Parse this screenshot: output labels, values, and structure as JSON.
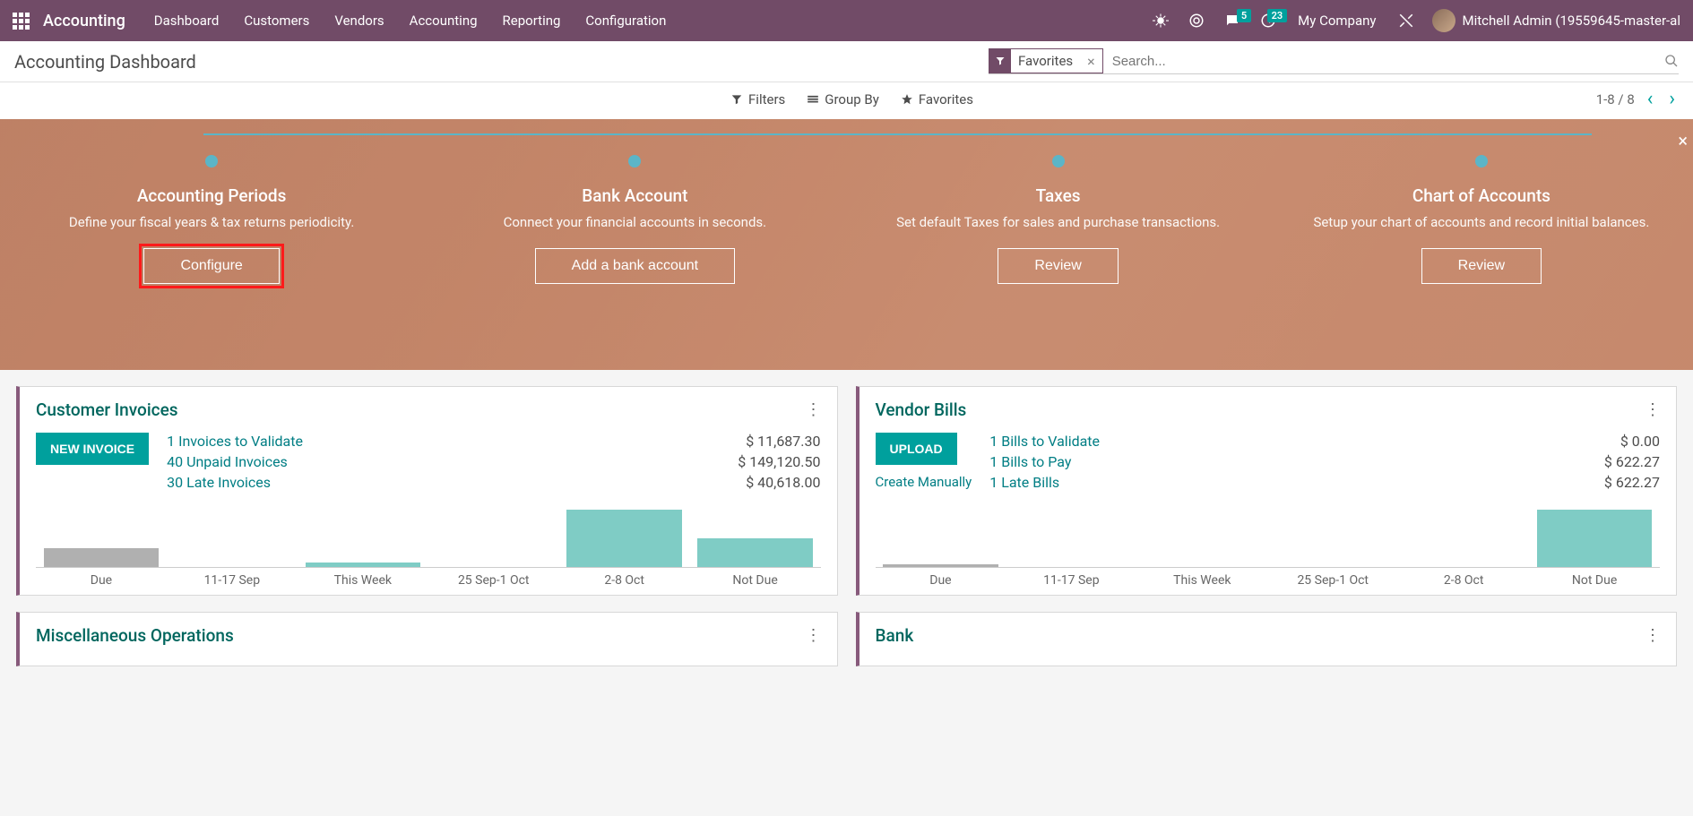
{
  "topbar": {
    "app_name": "Accounting",
    "menu": [
      "Dashboard",
      "Customers",
      "Vendors",
      "Accounting",
      "Reporting",
      "Configuration"
    ],
    "msg_badge": "5",
    "act_badge": "23",
    "company": "My Company",
    "user": "Mitchell Admin (19559645-master-al"
  },
  "page": {
    "title": "Accounting Dashboard",
    "facet_label": "Favorites",
    "search_placeholder": "Search...",
    "filters": "Filters",
    "groupby": "Group By",
    "favorites": "Favorites",
    "pager": "1-8 / 8"
  },
  "steps": [
    {
      "title": "Accounting Periods",
      "desc": "Define your fiscal years & tax returns periodicity.",
      "btn": "Configure",
      "hl": true
    },
    {
      "title": "Bank Account",
      "desc": "Connect your financial accounts in seconds.",
      "btn": "Add a bank account",
      "hl": false
    },
    {
      "title": "Taxes",
      "desc": "Set default Taxes for sales and purchase transactions.",
      "btn": "Review",
      "hl": false
    },
    {
      "title": "Chart of Accounts",
      "desc": "Setup your chart of accounts and record initial balances.",
      "btn": "Review",
      "hl": false
    }
  ],
  "cards": {
    "ci": {
      "title": "Customer Invoices",
      "action": "NEW INVOICE",
      "stats": [
        {
          "label": "1 Invoices to Validate",
          "val": "$ 11,687.30"
        },
        {
          "label": "40 Unpaid Invoices",
          "val": "$ 149,120.50"
        },
        {
          "label": "30 Late Invoices",
          "val": "$ 40,618.00"
        }
      ]
    },
    "vb": {
      "title": "Vendor Bills",
      "action": "UPLOAD",
      "link": "Create Manually",
      "stats": [
        {
          "label": "1 Bills to Validate",
          "val": "$ 0.00"
        },
        {
          "label": "1 Bills to Pay",
          "val": "$ 622.27"
        },
        {
          "label": "1 Late Bills",
          "val": "$ 622.27"
        }
      ]
    },
    "misc": {
      "title": "Miscellaneous Operations"
    },
    "bank": {
      "title": "Bank"
    }
  },
  "chart_data": [
    {
      "type": "bar",
      "title": "Customer Invoices",
      "categories": [
        "Due",
        "11-17 Sep",
        "This Week",
        "25 Sep-1 Oct",
        "2-8 Oct",
        "Not Due"
      ],
      "values": [
        18,
        0,
        4,
        0,
        56,
        28
      ],
      "ylim": [
        0,
        60
      ],
      "colors": [
        "past",
        "fut",
        "fut",
        "fut",
        "fut",
        "fut"
      ]
    },
    {
      "type": "bar",
      "title": "Vendor Bills",
      "categories": [
        "Due",
        "11-17 Sep",
        "This Week",
        "25 Sep-1 Oct",
        "2-8 Oct",
        "Not Due"
      ],
      "values": [
        3,
        0,
        0,
        0,
        0,
        56
      ],
      "ylim": [
        0,
        60
      ],
      "colors": [
        "past",
        "fut",
        "fut",
        "fut",
        "fut",
        "fut"
      ]
    }
  ]
}
